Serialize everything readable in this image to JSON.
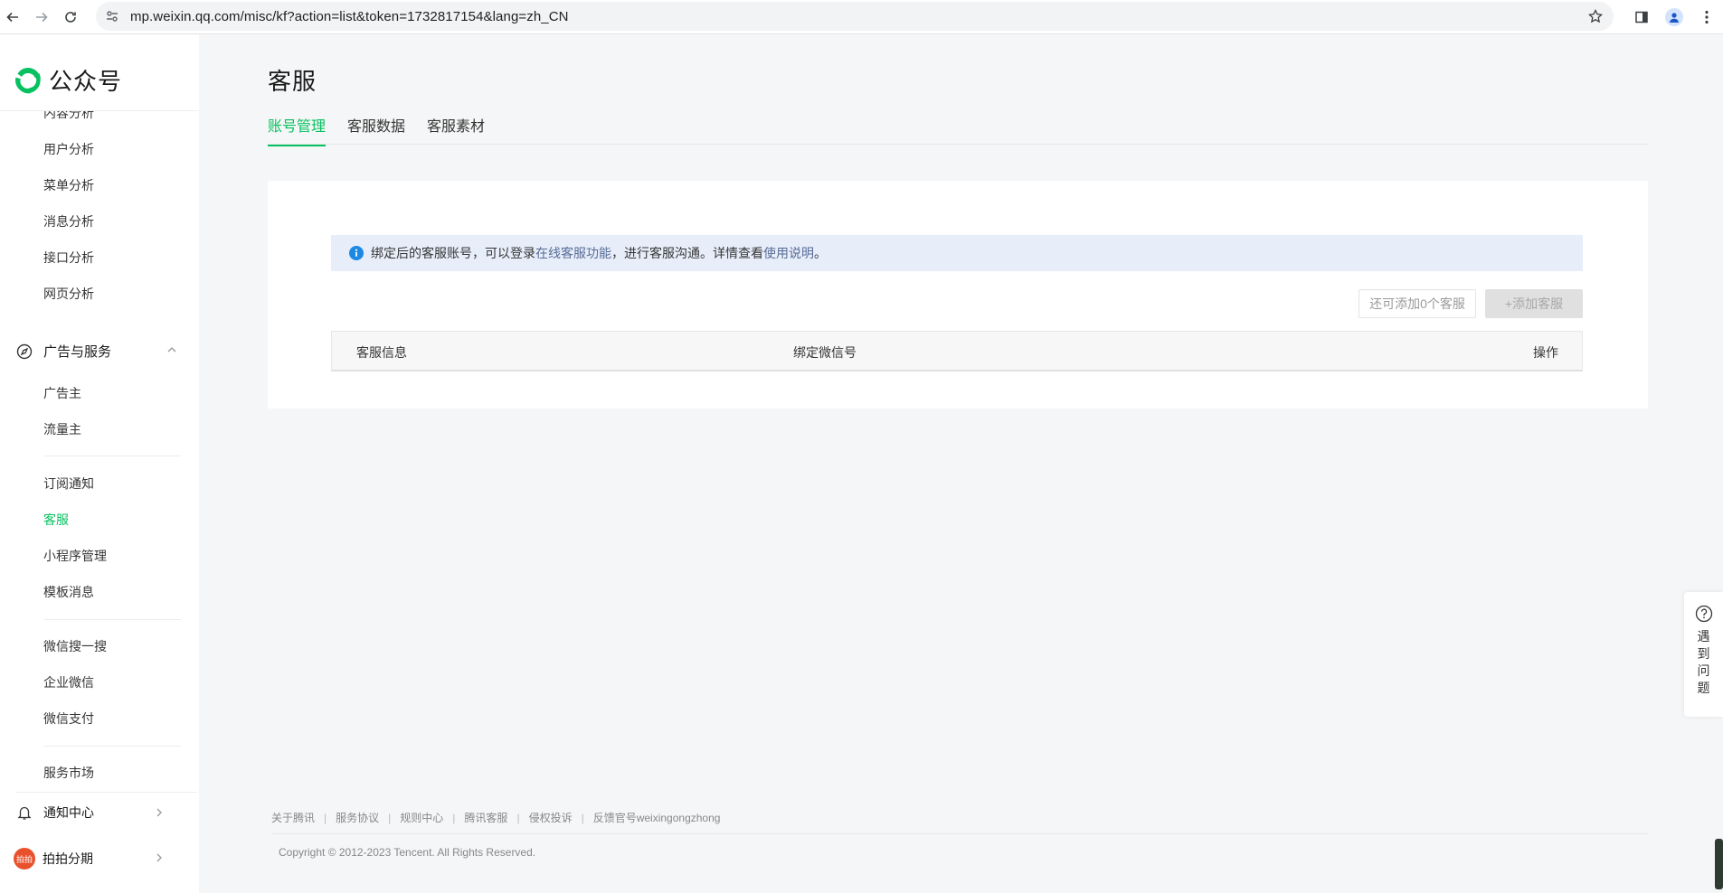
{
  "browser": {
    "url": "mp.weixin.qq.com/misc/kf?action=list&token=1732817154&lang=zh_CN"
  },
  "logo": {
    "text": "公众号",
    "brand_color": "#07c160"
  },
  "sidebar": {
    "top_partial": "内容分析",
    "analysis_items": [
      "用户分析",
      "菜单分析",
      "消息分析",
      "接口分析",
      "网页分析"
    ],
    "ads_section": {
      "title": "广告与服务",
      "items": [
        "广告主",
        "流量主"
      ]
    },
    "feature_items": [
      "订阅通知",
      "客服",
      "小程序管理",
      "模板消息"
    ],
    "active_item": "客服",
    "wechat_items": [
      "微信搜一搜",
      "企业微信",
      "微信支付"
    ],
    "bottom_partial": "服务市场",
    "notify": "通知中心",
    "paipai": "拍拍分期",
    "paipai_badge": "拍拍"
  },
  "page": {
    "title": "客服",
    "tabs": [
      "账号管理",
      "客服数据",
      "客服素材"
    ]
  },
  "notice": {
    "text_before": "绑定后的客服账号，可以登录",
    "link1": "在线客服功能",
    "text_middle": "，进行客服沟通。详情查看",
    "link2": "使用说明",
    "text_after": "。"
  },
  "buttons": {
    "count": "还可添加0个客服",
    "add": "+添加客服"
  },
  "table": {
    "columns": [
      "客服信息",
      "绑定微信号",
      "操作"
    ]
  },
  "footer": {
    "links": [
      "关于腾讯",
      "服务协议",
      "规则中心",
      "腾讯客服",
      "侵权投诉",
      "反馈官号weixingongzhong"
    ],
    "copyright": "Copyright © 2012-2023 Tencent. All Rights Reserved."
  },
  "help": {
    "text": "遇到问题"
  }
}
